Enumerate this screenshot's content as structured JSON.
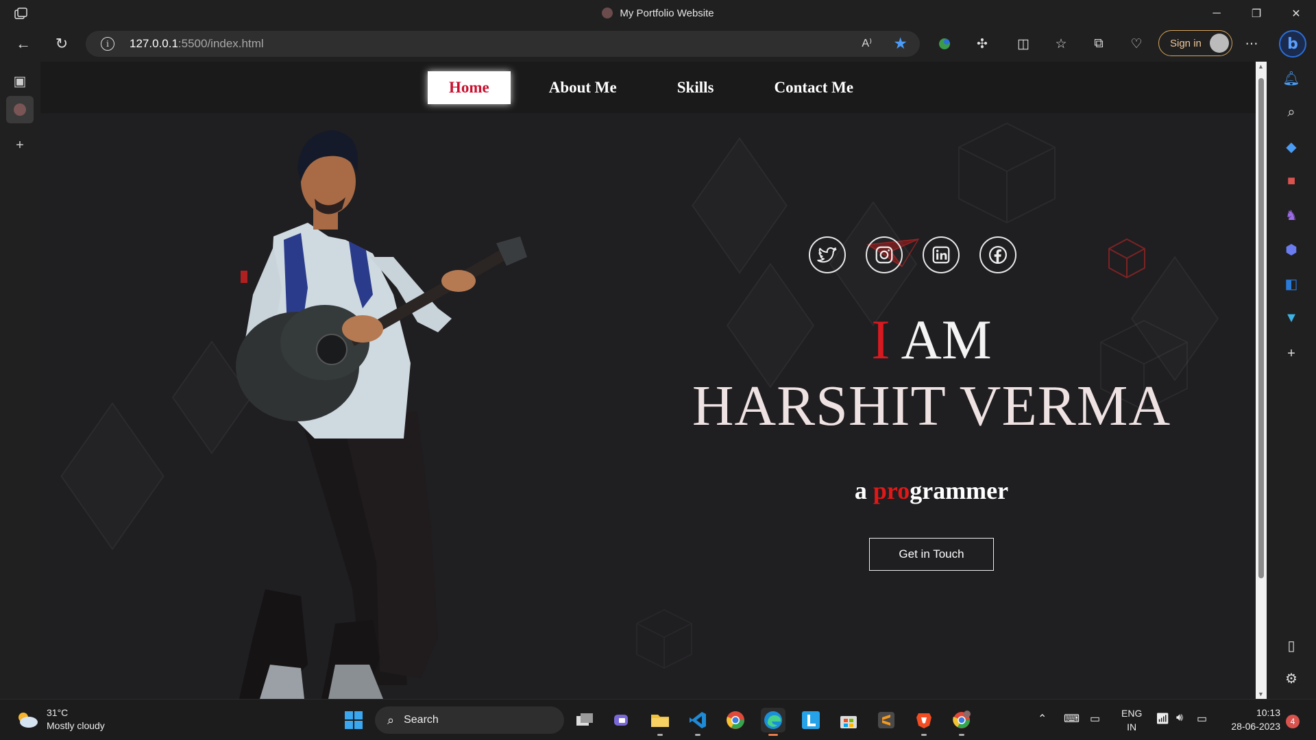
{
  "browser": {
    "tab_title": "My Portfolio Website",
    "url_host": "127.0.0.1",
    "url_rest": ":5500/index.html",
    "signin_label": "Sign in"
  },
  "nav": {
    "links": [
      {
        "label": "Home",
        "active": true
      },
      {
        "label": "About Me",
        "active": false
      },
      {
        "label": "Skills",
        "active": false
      },
      {
        "label": "Contact Me",
        "active": false
      }
    ]
  },
  "hero": {
    "iam_red": "I",
    "iam_rest": " AM",
    "name": "HARSHIT VERMA",
    "tagline_prefix": "a ",
    "tagline_red": "pro",
    "tagline_rest": "grammer",
    "cta_label": "Get in Touch"
  },
  "socials": [
    "twitter-icon",
    "instagram-icon",
    "linkedin-icon",
    "facebook-icon"
  ],
  "colors": {
    "accent_red": "#d71920",
    "page_bg": "#1f1e21"
  },
  "taskbar": {
    "temperature": "31°C",
    "weather": "Mostly cloudy",
    "search_placeholder": "Search",
    "lang_top": "ENG",
    "lang_bottom": "IN",
    "time": "10:13",
    "date": "28-06-2023",
    "notif_count": "4"
  }
}
